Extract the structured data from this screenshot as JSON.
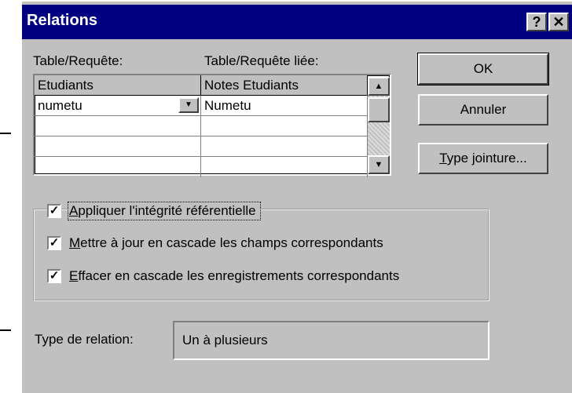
{
  "window": {
    "title": "Relations",
    "help_label": "?",
    "close_label": "✕"
  },
  "labels": {
    "table": "Table/Requête:",
    "linked_table": "Table/Requête liée:"
  },
  "grid": {
    "header_left": "Etudiants",
    "header_right": "Notes Etudiants",
    "rows": [
      {
        "left": "numetu",
        "right": "Numetu"
      },
      {
        "left": "",
        "right": ""
      },
      {
        "left": "",
        "right": ""
      },
      {
        "left": "",
        "right": ""
      }
    ]
  },
  "buttons": {
    "ok": "OK",
    "cancel": "Annuler",
    "join_type_underline": "T",
    "join_type_rest": "ype jointure..."
  },
  "integrity": {
    "enforce": {
      "checked": true,
      "underline": "A",
      "rest": "ppliquer l'intégrité référentielle"
    },
    "cascade_update": {
      "checked": true,
      "underline": "M",
      "rest": "ettre à jour en cascade les champs correspondants"
    },
    "cascade_delete": {
      "checked": true,
      "underline": "E",
      "rest": "ffacer en cascade les enregistrements correspondants"
    }
  },
  "relation": {
    "label": "Type de relation:",
    "value": "Un à plusieurs"
  },
  "icons": {
    "help": "help-icon",
    "close": "close-icon",
    "dropdown": "chevron-down-icon",
    "scroll_up": "arrow-up-icon",
    "scroll_down": "arrow-down-icon",
    "checkmark": "checkmark-icon"
  },
  "colors": {
    "titlebar": "#000080",
    "face": "#c0c0c0"
  }
}
